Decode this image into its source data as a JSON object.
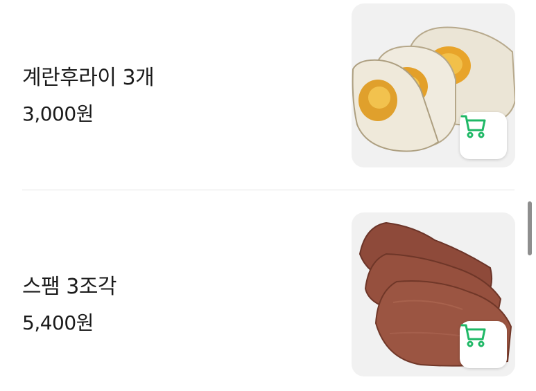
{
  "menu": {
    "items": [
      {
        "name": "계란후라이 3개",
        "price": "3,000원",
        "image": "fried-eggs-photo",
        "cart_icon": "cart-icon"
      },
      {
        "name": "스팸 3조각",
        "price": "5,400원",
        "image": "spam-slices-photo",
        "cart_icon": "cart-icon"
      }
    ]
  },
  "colors": {
    "accent": "#1fb866",
    "text": "#1a1a1a",
    "thumb_bg": "#f1f1f1",
    "divider": "#e3e3e3"
  }
}
